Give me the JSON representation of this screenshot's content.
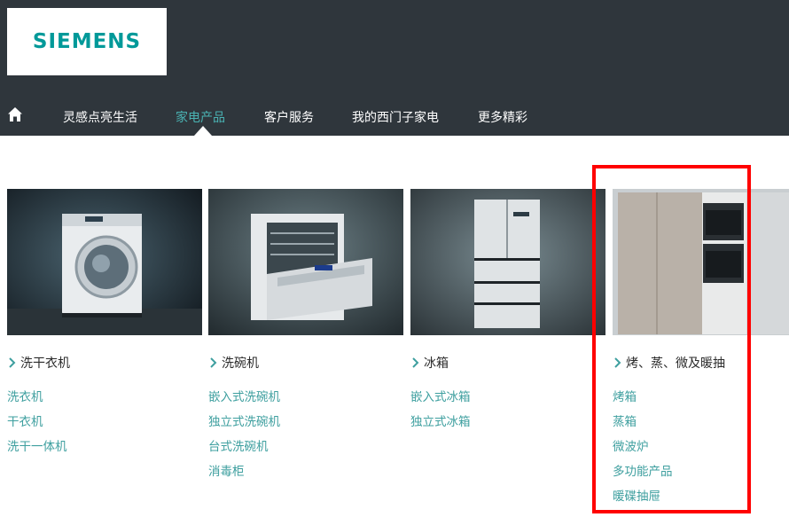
{
  "brand": {
    "logo_text": "SIEMENS"
  },
  "nav": {
    "home_icon": "home-icon",
    "items": [
      {
        "label": "灵感点亮生活",
        "active": false
      },
      {
        "label": "家电产品",
        "active": true
      },
      {
        "label": "客户服务",
        "active": false
      },
      {
        "label": "我的西门子家电",
        "active": false
      },
      {
        "label": "更多精彩",
        "active": false
      }
    ]
  },
  "categories": [
    {
      "title": "洗干衣机",
      "image": "washing-machine",
      "links": [
        "洗衣机",
        "干衣机",
        "洗干一体机"
      ]
    },
    {
      "title": "洗碗机",
      "image": "dishwasher",
      "links": [
        "嵌入式洗碗机",
        "独立式洗碗机",
        "台式洗碗机",
        "消毒柜"
      ]
    },
    {
      "title": "冰箱",
      "image": "refrigerator",
      "links": [
        "嵌入式冰箱",
        "独立式冰箱"
      ]
    },
    {
      "title": "烤、蒸、微及暖抽",
      "image": "built-in-oven",
      "links": [
        "烤箱",
        "蒸箱",
        "微波炉",
        "多功能产品",
        "暖碟抽屉"
      ]
    }
  ],
  "colors": {
    "header_bg": "#2f363c",
    "brand_teal": "#009999",
    "link_teal": "#3e9f9f",
    "highlight": "#ff0000"
  }
}
